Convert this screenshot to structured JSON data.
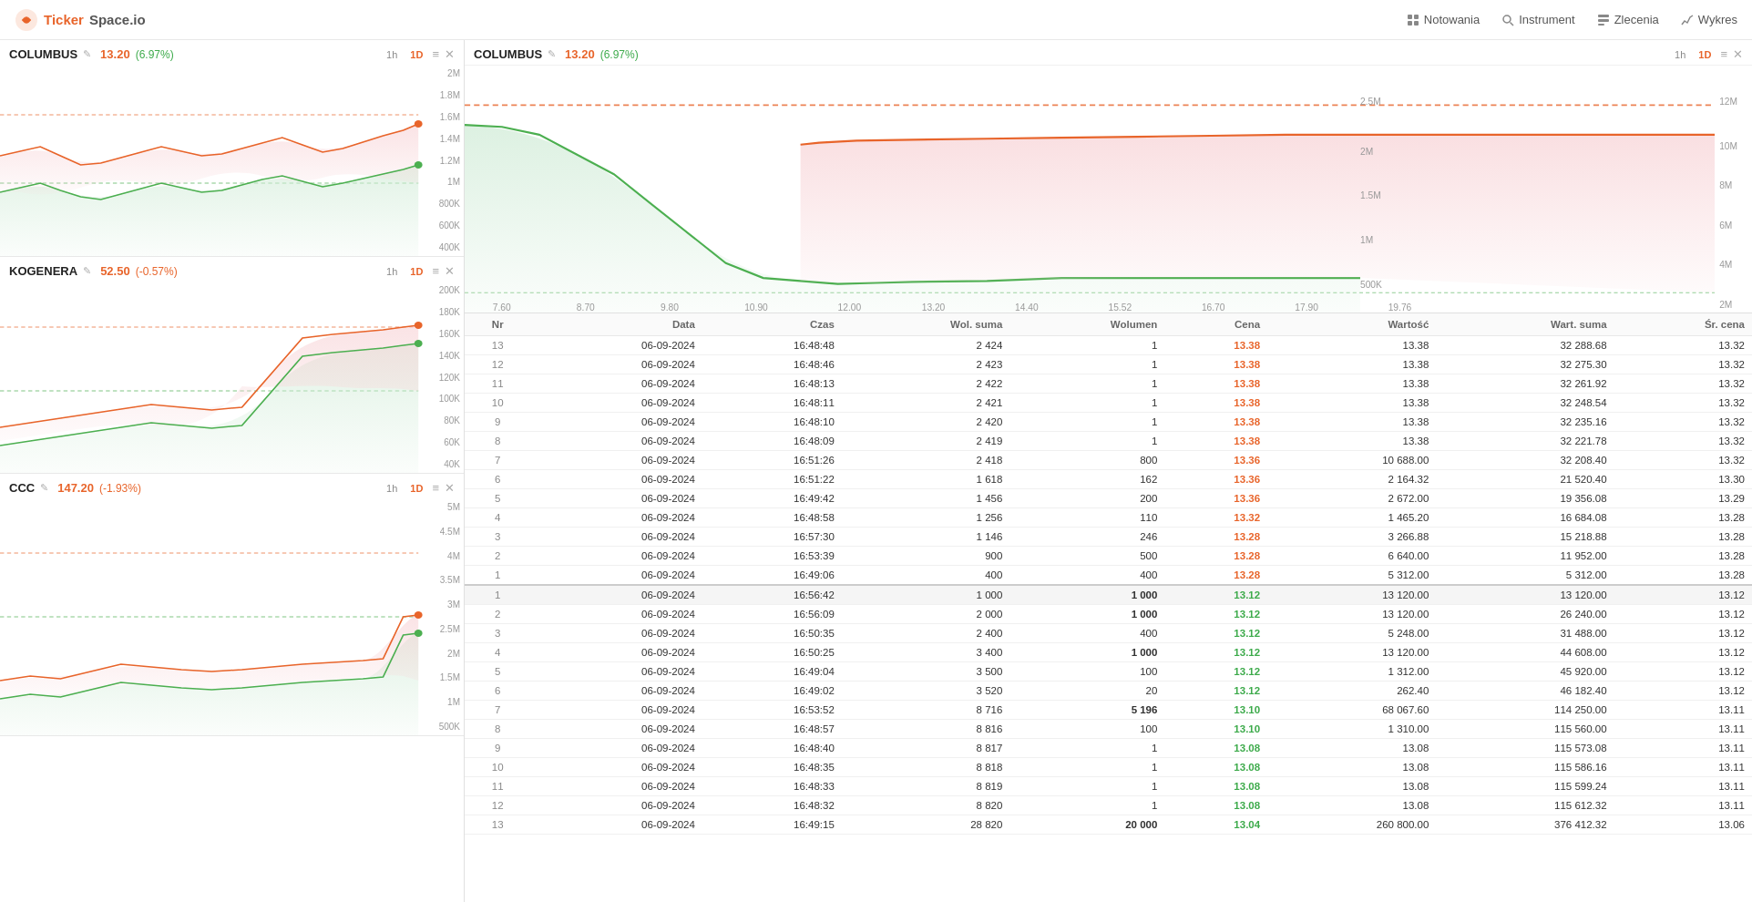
{
  "app": {
    "name": "TickerSpace.io",
    "logo_ticker": "Ticker",
    "logo_space": "Space.io"
  },
  "nav": {
    "items": [
      {
        "id": "notowania",
        "label": "Notowania",
        "icon": "grid-icon"
      },
      {
        "id": "instrument",
        "label": "Instrument",
        "icon": "search-icon"
      },
      {
        "id": "zlecenia",
        "label": "Zlecenia",
        "icon": "orders-icon"
      },
      {
        "id": "wykres",
        "label": "Wykres",
        "icon": "chart-icon"
      }
    ]
  },
  "left_charts": [
    {
      "id": "columbus-left",
      "ticker": "COLUMBUS",
      "price": "13.20",
      "change": "(6.97%)",
      "change_sign": "positive",
      "timeframes": [
        "1h",
        "1D"
      ],
      "active_tf": "1D",
      "yaxis": [
        "2M",
        "1.8M",
        "1.6M",
        "1.4M",
        "1.2M",
        "1M",
        "800K",
        "600K",
        "400K"
      ]
    },
    {
      "id": "kogenera-left",
      "ticker": "KOGENERA",
      "price": "52.50",
      "change": "(-0.57%)",
      "change_sign": "negative",
      "timeframes": [
        "1h",
        "1D"
      ],
      "active_tf": "1D",
      "yaxis": [
        "200K",
        "180K",
        "160K",
        "140K",
        "120K",
        "100K",
        "80K",
        "60K",
        "40K"
      ]
    },
    {
      "id": "ccc-left",
      "ticker": "CCC",
      "price": "147.20",
      "change": "(-1.93%)",
      "change_sign": "negative",
      "timeframes": [
        "1h",
        "1D"
      ],
      "active_tf": "1D",
      "yaxis": [
        "5M",
        "4.5M",
        "4M",
        "3.5M",
        "3M",
        "2.5M",
        "2M",
        "1.5M",
        "1M",
        "500K"
      ]
    }
  ],
  "right_chart": {
    "ticker": "COLUMBUS",
    "price": "13.20",
    "change": "(6.97%)",
    "change_sign": "positive",
    "timeframes": [
      "1h",
      "1D"
    ],
    "active_tf": "1D",
    "xaxis": [
      "7.60",
      "8.70",
      "9.80",
      "10.90",
      "12.00",
      "13.20",
      "14.40",
      "15.52",
      "16.70",
      "17.90",
      "19.76"
    ],
    "yaxis_left": [
      "2.5M",
      "2M",
      "1.5M",
      "1M",
      "500K"
    ],
    "yaxis_right": [
      "12M",
      "10M",
      "8M",
      "6M",
      "4M",
      "2M"
    ]
  },
  "table": {
    "headers": [
      "Nr",
      "Data",
      "Czas",
      "Wol. suma",
      "Wolumen",
      "Cena",
      "Wartość",
      "Wart. suma",
      "Śr. cena"
    ],
    "sell_rows": [
      {
        "nr": "13",
        "data": "06-09-2024",
        "czas": "16:48:48",
        "wol_suma": "2 424",
        "wolumen": "1",
        "cena": "13.38",
        "wartosc": "13.38",
        "wart_suma": "32 288.68",
        "sr_cena": "13.32"
      },
      {
        "nr": "12",
        "data": "06-09-2024",
        "czas": "16:48:46",
        "wol_suma": "2 423",
        "wolumen": "1",
        "cena": "13.38",
        "wartosc": "13.38",
        "wart_suma": "32 275.30",
        "sr_cena": "13.32"
      },
      {
        "nr": "11",
        "data": "06-09-2024",
        "czas": "16:48:13",
        "wol_suma": "2 422",
        "wolumen": "1",
        "cena": "13.38",
        "wartosc": "13.38",
        "wart_suma": "32 261.92",
        "sr_cena": "13.32"
      },
      {
        "nr": "10",
        "data": "06-09-2024",
        "czas": "16:48:11",
        "wol_suma": "2 421",
        "wolumen": "1",
        "cena": "13.38",
        "wartosc": "13.38",
        "wart_suma": "32 248.54",
        "sr_cena": "13.32"
      },
      {
        "nr": "9",
        "data": "06-09-2024",
        "czas": "16:48:10",
        "wol_suma": "2 420",
        "wolumen": "1",
        "cena": "13.38",
        "wartosc": "13.38",
        "wart_suma": "32 235.16",
        "sr_cena": "13.32"
      },
      {
        "nr": "8",
        "data": "06-09-2024",
        "czas": "16:48:09",
        "wol_suma": "2 419",
        "wolumen": "1",
        "cena": "13.38",
        "wartosc": "13.38",
        "wart_suma": "32 221.78",
        "sr_cena": "13.32"
      },
      {
        "nr": "7",
        "data": "06-09-2024",
        "czas": "16:51:26",
        "wol_suma": "2 418",
        "wolumen": "800",
        "cena": "13.36",
        "wartosc": "10 688.00",
        "wart_suma": "32 208.40",
        "sr_cena": "13.32"
      },
      {
        "nr": "6",
        "data": "06-09-2024",
        "czas": "16:51:22",
        "wol_suma": "1 618",
        "wolumen": "162",
        "cena": "13.36",
        "wartosc": "2 164.32",
        "wart_suma": "21 520.40",
        "sr_cena": "13.30"
      },
      {
        "nr": "5",
        "data": "06-09-2024",
        "czas": "16:49:42",
        "wol_suma": "1 456",
        "wolumen": "200",
        "cena": "13.36",
        "wartosc": "2 672.00",
        "wart_suma": "19 356.08",
        "sr_cena": "13.29"
      },
      {
        "nr": "4",
        "data": "06-09-2024",
        "czas": "16:48:58",
        "wol_suma": "1 256",
        "wolumen": "110",
        "cena": "13.32",
        "wartosc": "1 465.20",
        "wart_suma": "16 684.08",
        "sr_cena": "13.28"
      },
      {
        "nr": "3",
        "data": "06-09-2024",
        "czas": "16:57:30",
        "wol_suma": "1 146",
        "wolumen": "246",
        "cena": "13.28",
        "wartosc": "3 266.88",
        "wart_suma": "15 218.88",
        "sr_cena": "13.28"
      },
      {
        "nr": "2",
        "data": "06-09-2024",
        "czas": "16:53:39",
        "wol_suma": "900",
        "wolumen": "500",
        "cena": "13.28",
        "wartosc": "6 640.00",
        "wart_suma": "11 952.00",
        "sr_cena": "13.28"
      },
      {
        "nr": "1",
        "data": "06-09-2024",
        "czas": "16:49:06",
        "wol_suma": "400",
        "wolumen": "400",
        "cena": "13.28",
        "wartosc": "5 312.00",
        "wart_suma": "5 312.00",
        "sr_cena": "13.28"
      }
    ],
    "buy_rows": [
      {
        "nr": "1",
        "data": "06-09-2024",
        "czas": "16:56:42",
        "wol_suma": "1 000",
        "wolumen": "1 000",
        "cena": "13.12",
        "wartosc": "13 120.00",
        "wart_suma": "13 120.00",
        "sr_cena": "13.12"
      },
      {
        "nr": "2",
        "data": "06-09-2024",
        "czas": "16:56:09",
        "wol_suma": "2 000",
        "wolumen": "1 000",
        "cena": "13.12",
        "wartosc": "13 120.00",
        "wart_suma": "26 240.00",
        "sr_cena": "13.12"
      },
      {
        "nr": "3",
        "data": "06-09-2024",
        "czas": "16:50:35",
        "wol_suma": "2 400",
        "wolumen": "400",
        "cena": "13.12",
        "wartosc": "5 248.00",
        "wart_suma": "31 488.00",
        "sr_cena": "13.12"
      },
      {
        "nr": "4",
        "data": "06-09-2024",
        "czas": "16:50:25",
        "wol_suma": "3 400",
        "wolumen": "1 000",
        "cena": "13.12",
        "wartosc": "13 120.00",
        "wart_suma": "44 608.00",
        "sr_cena": "13.12"
      },
      {
        "nr": "5",
        "data": "06-09-2024",
        "czas": "16:49:04",
        "wol_suma": "3 500",
        "wolumen": "100",
        "cena": "13.12",
        "wartosc": "1 312.00",
        "wart_suma": "45 920.00",
        "sr_cena": "13.12"
      },
      {
        "nr": "6",
        "data": "06-09-2024",
        "czas": "16:49:02",
        "wol_suma": "3 520",
        "wolumen": "20",
        "cena": "13.12",
        "wartosc": "262.40",
        "wart_suma": "46 182.40",
        "sr_cena": "13.12"
      },
      {
        "nr": "7",
        "data": "06-09-2024",
        "czas": "16:53:52",
        "wol_suma": "8 716",
        "wolumen": "5 196",
        "cena": "13.10",
        "wartosc": "68 067.60",
        "wart_suma": "114 250.00",
        "sr_cena": "13.11"
      },
      {
        "nr": "8",
        "data": "06-09-2024",
        "czas": "16:48:57",
        "wol_suma": "8 816",
        "wolumen": "100",
        "cena": "13.10",
        "wartosc": "1 310.00",
        "wart_suma": "115 560.00",
        "sr_cena": "13.11"
      },
      {
        "nr": "9",
        "data": "06-09-2024",
        "czas": "16:48:40",
        "wol_suma": "8 817",
        "wolumen": "1",
        "cena": "13.08",
        "wartosc": "13.08",
        "wart_suma": "115 573.08",
        "sr_cena": "13.11"
      },
      {
        "nr": "10",
        "data": "06-09-2024",
        "czas": "16:48:35",
        "wol_suma": "8 818",
        "wolumen": "1",
        "cena": "13.08",
        "wartosc": "13.08",
        "wart_suma": "115 586.16",
        "sr_cena": "13.11"
      },
      {
        "nr": "11",
        "data": "06-09-2024",
        "czas": "16:48:33",
        "wol_suma": "8 819",
        "wolumen": "1",
        "cena": "13.08",
        "wartosc": "13.08",
        "wart_suma": "115 599.24",
        "sr_cena": "13.11"
      },
      {
        "nr": "12",
        "data": "06-09-2024",
        "czas": "16:48:32",
        "wol_suma": "8 820",
        "wolumen": "1",
        "cena": "13.08",
        "wartosc": "13.08",
        "wart_suma": "115 612.32",
        "sr_cena": "13.11"
      },
      {
        "nr": "13",
        "data": "06-09-2024",
        "czas": "16:49:15",
        "wol_suma": "28 820",
        "wolumen": "20 000",
        "cena": "13.04",
        "wartosc": "260 800.00",
        "wart_suma": "376 412.32",
        "sr_cena": "13.06"
      }
    ]
  }
}
